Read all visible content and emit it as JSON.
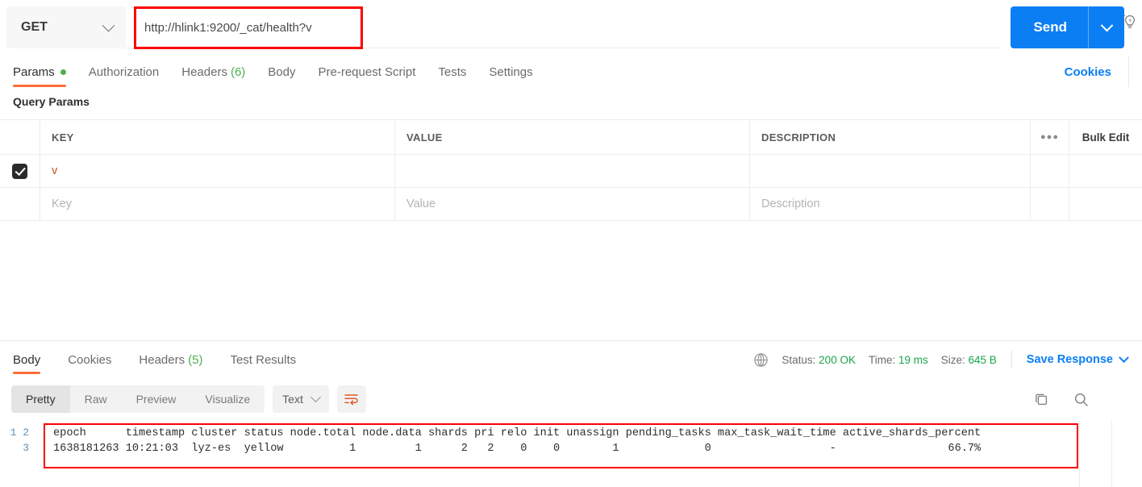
{
  "request": {
    "method": "GET",
    "url": "http://hlink1:9200/_cat/health?v",
    "send_label": "Send",
    "bulb_icon": "lightbulb-idea-icon",
    "tabs": [
      {
        "label": "Params",
        "dot": true,
        "active": true
      },
      {
        "label": "Authorization",
        "active": false
      },
      {
        "label": "Headers",
        "count": "(6)",
        "active": false
      },
      {
        "label": "Body",
        "active": false
      },
      {
        "label": "Pre-request Script",
        "active": false
      },
      {
        "label": "Tests",
        "active": false
      },
      {
        "label": "Settings",
        "active": false
      }
    ],
    "cookies_link": "Cookies",
    "query_params_title": "Query Params",
    "table": {
      "headers": [
        "KEY",
        "VALUE",
        "DESCRIPTION"
      ],
      "dots_icon": "more-options-icon",
      "bulk_edit": "Bulk Edit",
      "rows": [
        {
          "checked": true,
          "key": "v",
          "value": "",
          "description": ""
        },
        {
          "checked": false,
          "key": "Key",
          "value": "Value",
          "description": "Description",
          "placeholder": true
        }
      ]
    }
  },
  "response": {
    "tabs": [
      {
        "label": "Body",
        "active": true
      },
      {
        "label": "Cookies",
        "active": false
      },
      {
        "label": "Headers",
        "count": "(5)",
        "active": false
      },
      {
        "label": "Test Results",
        "active": false
      }
    ],
    "globe_icon": "globe-icon",
    "status_label": "Status:",
    "status_value": "200 OK",
    "time_label": "Time:",
    "time_value": "19 ms",
    "size_label": "Size:",
    "size_value": "645 B",
    "save_response": "Save Response",
    "view_modes": [
      {
        "label": "Pretty",
        "active": true
      },
      {
        "label": "Raw",
        "active": false
      },
      {
        "label": "Preview",
        "active": false
      },
      {
        "label": "Visualize",
        "active": false
      }
    ],
    "format": "Text",
    "wrap_icon": "word-wrap-icon",
    "copy_icon": "copy-icon",
    "search_icon": "search-icon",
    "line_numbers": [
      "1",
      "2",
      "3"
    ],
    "body_lines": [
      "epoch      timestamp cluster status node.total node.data shards pri relo init unassign pending_tasks max_task_wait_time active_shards_percent",
      "1638181263 10:21:03  lyz-es  yellow          1         1      2   2    0    0        1             0                  -                 66.7%"
    ]
  },
  "colors": {
    "accent_orange": "#ff6c37",
    "link_blue": "#0b7ef4",
    "success_green": "#1aa54a",
    "annotation_red": "#ff0000"
  }
}
